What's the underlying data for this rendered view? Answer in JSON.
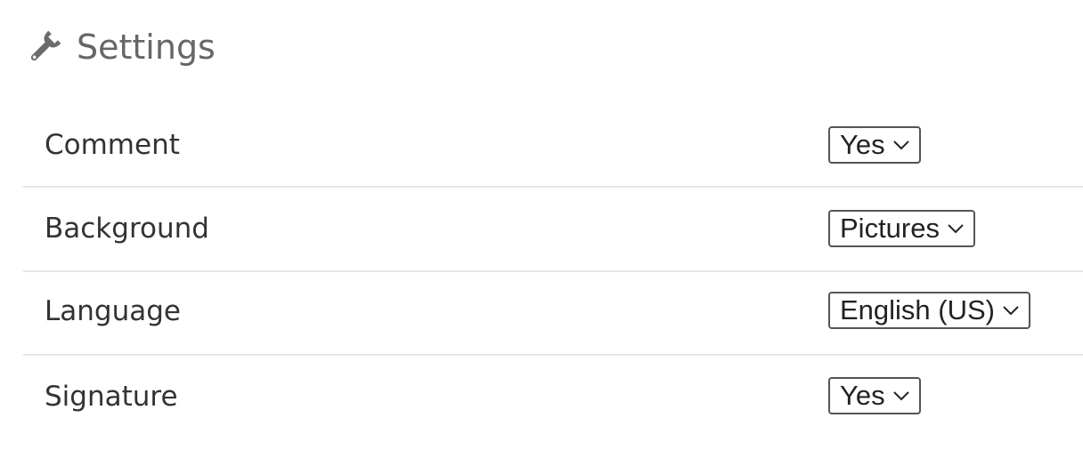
{
  "header": {
    "icon": "wrench-icon",
    "title": "Settings",
    "icon_color": "#6b6b6b"
  },
  "settings": [
    {
      "label": "Comment",
      "value": "Yes",
      "icon": "chevron-down-icon"
    },
    {
      "label": "Background",
      "value": "Pictures",
      "icon": "chevron-down-icon"
    },
    {
      "label": "Language",
      "value": "English (US)",
      "icon": "chevron-down-icon"
    },
    {
      "label": "Signature",
      "value": "Yes",
      "icon": "chevron-down-icon"
    }
  ],
  "colors": {
    "divider": "#e6e6e6",
    "title": "#666666",
    "text": "#333333"
  }
}
